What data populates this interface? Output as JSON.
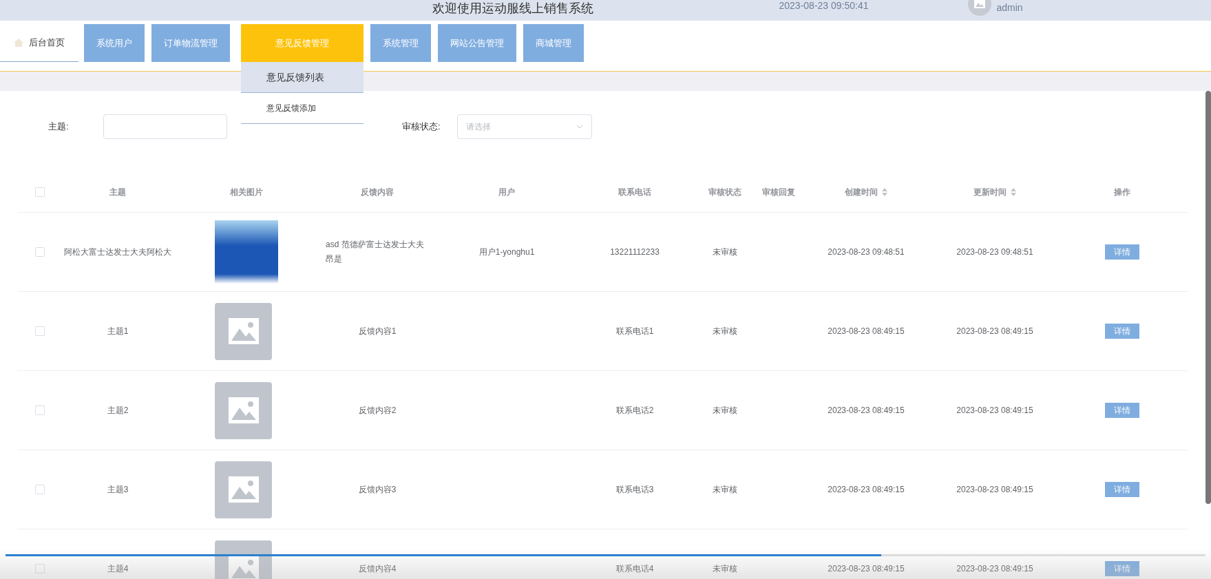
{
  "header": {
    "title": "欢迎使用运动服线上销售系统",
    "datetime": "2023-08-23 09:50:41",
    "user": "admin"
  },
  "nav": {
    "home": {
      "label": "后台首页",
      "selected": false
    },
    "tabs": [
      {
        "label": "系统用户",
        "selected": false
      },
      {
        "label": "订单物流管理",
        "selected": false
      },
      {
        "label": "意见反馈管理",
        "selected": true,
        "menu": [
          {
            "label": "意见反馈列表",
            "selected": true
          },
          {
            "label": "意见反馈添加",
            "selected": false
          }
        ]
      },
      {
        "label": "系统管理",
        "selected": false
      },
      {
        "label": "网站公告管理",
        "selected": false
      },
      {
        "label": "商城管理",
        "selected": false
      }
    ]
  },
  "filters": [
    {
      "kind": "input",
      "label": "主题:"
    },
    {
      "kind": "select",
      "label": "审核状态:",
      "placeholder": "请选择"
    }
  ],
  "table": {
    "select_all": {
      "checked": false
    },
    "columns": [
      {
        "label": "主题",
        "sortable": false
      },
      {
        "label": "相关图片",
        "sortable": false
      },
      {
        "label": "反馈内容",
        "sortable": false
      },
      {
        "label": "用户",
        "sortable": false
      },
      {
        "label": "联系电话",
        "sortable": false
      },
      {
        "label": "审核状态",
        "sortable": false
      },
      {
        "label": "审核回复",
        "sortable": false
      },
      {
        "label": "创建时间",
        "sortable": true
      },
      {
        "label": "更新时间",
        "sortable": true
      },
      {
        "label": "操作",
        "sortable": false
      }
    ],
    "rows": [
      {
        "checked": false,
        "subject": "阿松大富士达发士大夫阿松大",
        "kind": "photo",
        "content": "asd 范德萨富士达发士大夫昂是",
        "user": "用户1-yonghu1",
        "phone": "13221112233",
        "status": "未审核",
        "created": "2023-08-23 09:48:51",
        "updated": "2023-08-23 09:48:51",
        "action": "详情"
      },
      {
        "checked": false,
        "subject": "主题1",
        "kind": "placeholder",
        "content": "反馈内容1",
        "phone": "联系电话1",
        "status": "未审核",
        "created": "2023-08-23 08:49:15",
        "updated": "2023-08-23 08:49:15",
        "action": "详情"
      },
      {
        "checked": false,
        "subject": "主题2",
        "kind": "placeholder",
        "content": "反馈内容2",
        "phone": "联系电话2",
        "status": "未审核",
        "created": "2023-08-23 08:49:15",
        "updated": "2023-08-23 08:49:15",
        "action": "详情"
      },
      {
        "checked": false,
        "subject": "主题3",
        "kind": "placeholder",
        "content": "反馈内容3",
        "phone": "联系电话3",
        "status": "未审核",
        "created": "2023-08-23 08:49:15",
        "updated": "2023-08-23 08:49:15",
        "action": "详情"
      },
      {
        "checked": false,
        "subject": "主题4",
        "kind": "placeholder",
        "content": "反馈内容4",
        "phone": "联系电话4",
        "status": "未审核",
        "created": "2023-08-23 08:49:15",
        "updated": "2023-08-23 08:49:15",
        "action": "详情"
      }
    ]
  },
  "player": {
    "level": 0.73
  }
}
